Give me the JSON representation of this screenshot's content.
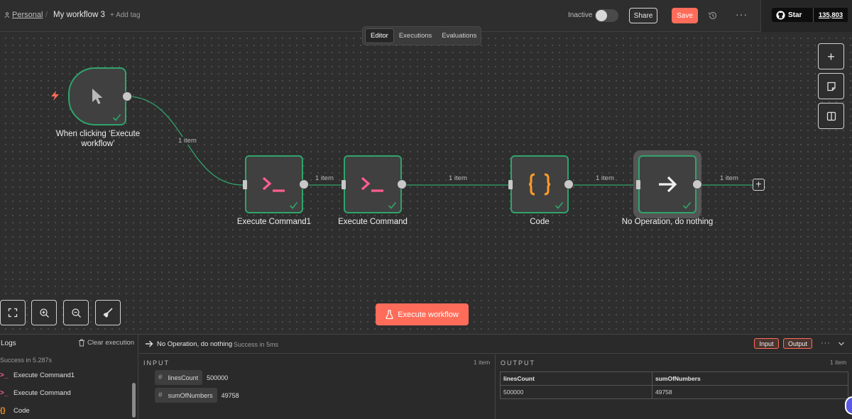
{
  "header": {
    "project": "Personal",
    "separator": "/",
    "workflow_name": "My workflow 3",
    "add_tag": "+ Add tag",
    "status_label": "Inactive",
    "share_label": "Share",
    "save_label": "Save",
    "more_label": "···",
    "github_star_label": "Star",
    "github_star_count": "135,803"
  },
  "tabs": [
    {
      "label": "Editor",
      "active": true
    },
    {
      "label": "Executions",
      "active": false
    },
    {
      "label": "Evaluations",
      "active": false
    }
  ],
  "nodes": {
    "trigger": {
      "label_line1": "When clicking ‘Execute",
      "label_line2": "workflow’"
    },
    "exec_cmd1": {
      "label": "Execute Command1"
    },
    "exec_cmd": {
      "label": "Execute Command"
    },
    "code": {
      "label": "Code"
    },
    "noop": {
      "label": "No Operation, do nothing"
    }
  },
  "edges": {
    "e1": "1 item",
    "e2": "1 item",
    "e3": "1 item",
    "e4": "1 item",
    "e5": "1 item"
  },
  "canvas_controls": {
    "add_node": "+",
    "plus_end": "+"
  },
  "execute_button": "Execute workflow",
  "logs": {
    "title": "Logs",
    "clear_label": "Clear execution",
    "status": "Success in 5.287s",
    "items": [
      {
        "icon": ">_",
        "label": "Execute Command1"
      },
      {
        "icon": ">_",
        "label": "Execute Command"
      },
      {
        "icon": "{}",
        "label": "Code"
      }
    ]
  },
  "output_header": {
    "node_name": "No Operation, do nothing",
    "status": "Success in 5ms",
    "input_pill": "Input",
    "output_pill": "Output",
    "more": "···"
  },
  "input_panel": {
    "title": "INPUT",
    "count": "1 item",
    "fields": [
      {
        "hash": "#",
        "name": "linesCount",
        "value": "500000"
      },
      {
        "hash": "#",
        "name": "sumOfNumbers",
        "value": "49758"
      }
    ]
  },
  "output_panel": {
    "title": "OUTPUT",
    "count": "1 item",
    "columns": [
      "linesCount",
      "sumOfNumbers"
    ],
    "rows": [
      [
        "500000",
        "49758"
      ]
    ]
  },
  "colors": {
    "accent": "#ff6d5a",
    "success": "#30a46c",
    "canvas": "#2e2e2e",
    "command_icon": "#ff5d8f",
    "code_icon": "#ff9b26"
  }
}
